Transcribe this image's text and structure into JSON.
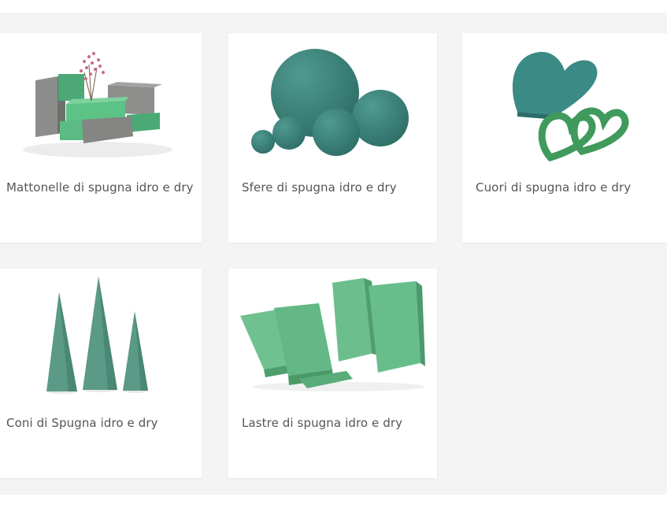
{
  "categories": [
    {
      "label": "Mattonelle di spugna idro e dry",
      "image": "foam-bricks-image"
    },
    {
      "label": "Sfere di spugna idro e dry",
      "image": "foam-spheres-image"
    },
    {
      "label": "Cuori di spugna idro e dry",
      "image": "foam-hearts-image"
    },
    {
      "label": "Coni di Spugna idro e dry",
      "image": "foam-cones-image"
    },
    {
      "label": "Lastre di spugna idro e dry",
      "image": "foam-slabs-image"
    }
  ],
  "colors": {
    "page_background": "#f4f4f4",
    "card_background": "#ffffff",
    "label_text": "#555555",
    "foam_green": "#5fb98a",
    "foam_teal": "#3f7f78",
    "foam_gray": "#8a8a88"
  }
}
